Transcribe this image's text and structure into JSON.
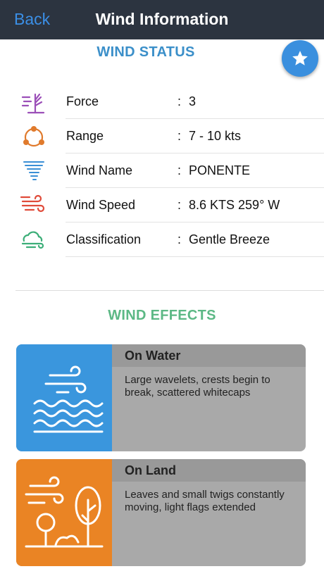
{
  "navbar": {
    "back_label": "Back",
    "title": "Wind Information"
  },
  "status": {
    "title": "WIND STATUS",
    "rows": [
      {
        "label": "Force",
        "colon": ":",
        "value": "3",
        "icon": "tree-wind-icon",
        "color": "#9b4fb8"
      },
      {
        "label": "Range",
        "colon": ":",
        "value": "7 - 10  kts",
        "icon": "range-cycle-icon",
        "color": "#e07a2c"
      },
      {
        "label": "Wind Name",
        "colon": ":",
        "value": "PONENTE",
        "icon": "tornado-icon",
        "color": "#3b8fd6"
      },
      {
        "label": "Wind Speed",
        "colon": ":",
        "value": "8.6 KTS 259° W",
        "icon": "wind-lines-icon",
        "color": "#e04b3a"
      },
      {
        "label": "Classification",
        "colon": ":",
        "value": "Gentle Breeze",
        "icon": "cloud-wind-icon",
        "color": "#3cae78"
      }
    ]
  },
  "effects": {
    "title": "WIND EFFECTS",
    "water": {
      "heading": "On Water",
      "text": "Large wavelets, crests begin to break, scattered whitecaps",
      "color": "#3a96dd",
      "icon": "waves-icon"
    },
    "land": {
      "heading": "On Land",
      "text": "Leaves and small twigs constantly moving, light flags extended",
      "color": "#ea8424",
      "icon": "trees-wind-icon"
    }
  },
  "fav": {
    "icon": "star-icon"
  }
}
